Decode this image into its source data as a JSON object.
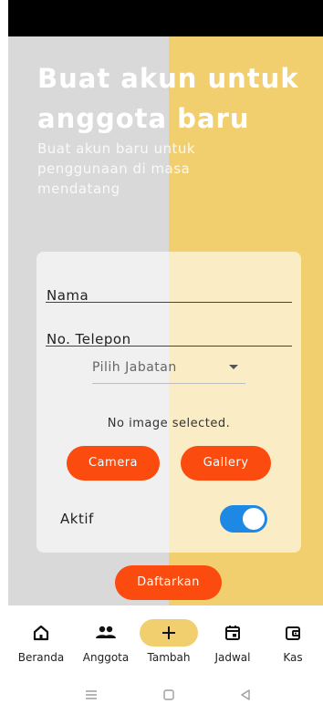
{
  "header": {
    "title": "Buat akun untuk anggota baru",
    "subtitle": "Buat akun baru untuk penggunaan di masa mendatang"
  },
  "form": {
    "nama_label": "Nama",
    "telepon_label": "No. Telepon",
    "jabatan_placeholder": "Pilih Jabatan",
    "image_status": "No image selected.",
    "camera_label": "Camera",
    "gallery_label": "Gallery",
    "aktif_label": "Aktif",
    "aktif_on": true,
    "submit_label": "Daftarkan"
  },
  "nav": {
    "items": [
      {
        "label": "Beranda",
        "icon": "home-icon"
      },
      {
        "label": "Anggota",
        "icon": "people-icon"
      },
      {
        "label": "Tambah",
        "icon": "plus-icon",
        "selected": true
      },
      {
        "label": "Jadwal",
        "icon": "calendar-icon"
      },
      {
        "label": "Kas",
        "icon": "wallet-icon"
      }
    ]
  },
  "colors": {
    "accent": "#fb4b0e",
    "yellow": "#f2cf6e",
    "gray": "#d9d9d9",
    "toggle": "#1e88e5"
  }
}
